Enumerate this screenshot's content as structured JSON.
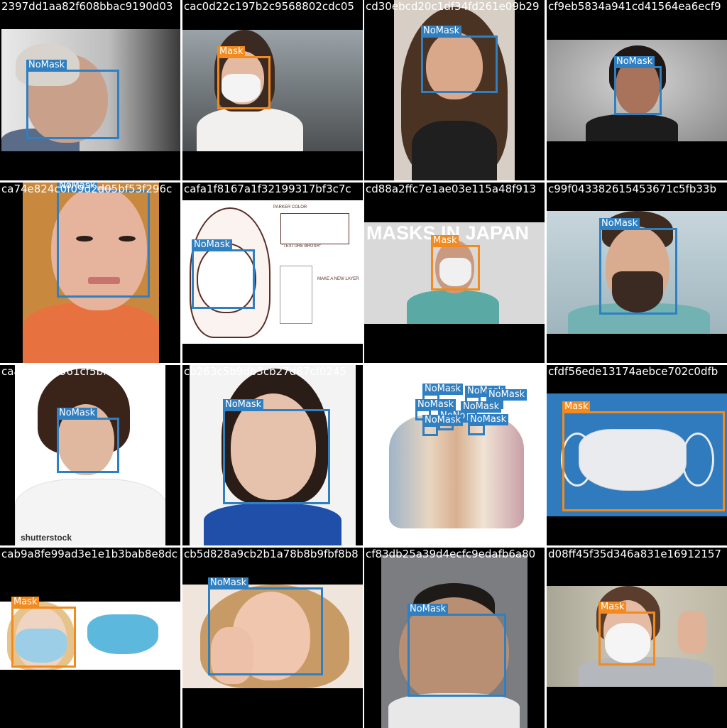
{
  "tiles": [
    {
      "title": "2397dd1aa82f608bbac9190d03",
      "labels": [
        "NoMask"
      ]
    },
    {
      "title": "cac0d22c197b2c9568802cdc05",
      "labels": [
        "Mask"
      ]
    },
    {
      "title": "cd30ebcd20c1df34fd261e09b29",
      "labels": [
        "NoMask"
      ]
    },
    {
      "title": "cf9eb5834a941cd41564ea6ecf9",
      "labels": [
        "NoMask"
      ]
    },
    {
      "title": "ca74e824c0f09d2d05bf53f296c",
      "labels": [
        "NoMask"
      ]
    },
    {
      "title": "cafa1f8167a1f32199317bf3c7c",
      "labels": [
        "NoMask"
      ],
      "sketch_notes": [
        "PARKER COLOR",
        "\"TEXTURE BRUSH\"",
        "MAKE A NEW LAYER"
      ]
    },
    {
      "title": "cd88a2ffc7e1ae03e115a48f913",
      "labels": [
        "Mask"
      ],
      "overlay_text": "MASKS IN JAPAN"
    },
    {
      "title": "c99f043382615453671c5fb33b",
      "labels": [
        "NoMask"
      ]
    },
    {
      "title": "caaca8ba4961cf5bf7f62f7287",
      "labels": [
        "NoMask"
      ],
      "watermark": "shutterstock"
    },
    {
      "title": "cb263c5b9db3cb27d87cf0245",
      "labels": [
        "NoMask"
      ]
    },
    {
      "title": "ccdacd60d3502e5b06c28dea7f0",
      "labels": [
        "NoMask",
        "NoMask",
        "NoMask",
        "NoMask",
        "NoMask",
        "NoNo",
        "NoMask",
        "NoMask"
      ]
    },
    {
      "title": "cfdf56ede13174aebce702c0dfb",
      "labels": [
        "Mask"
      ]
    },
    {
      "title": "cab9a8fe99ad3e1e1b3bab8e8dc",
      "labels": [
        "Mask"
      ]
    },
    {
      "title": "cb5d828a9cb2b1a78b8b9fbf8b8",
      "labels": [
        "NoMask"
      ]
    },
    {
      "title": "cf83db25a39d4ecfc9edafb6a80",
      "labels": [
        "NoMask"
      ]
    },
    {
      "title": "d08ff45f35d346a831e16912157",
      "labels": [
        "Mask"
      ]
    }
  ],
  "colors": {
    "nomask_box": "#2f7fc1",
    "mask_box": "#f28a1e",
    "tile_background": "#000000",
    "title_text": "#ffffff"
  }
}
